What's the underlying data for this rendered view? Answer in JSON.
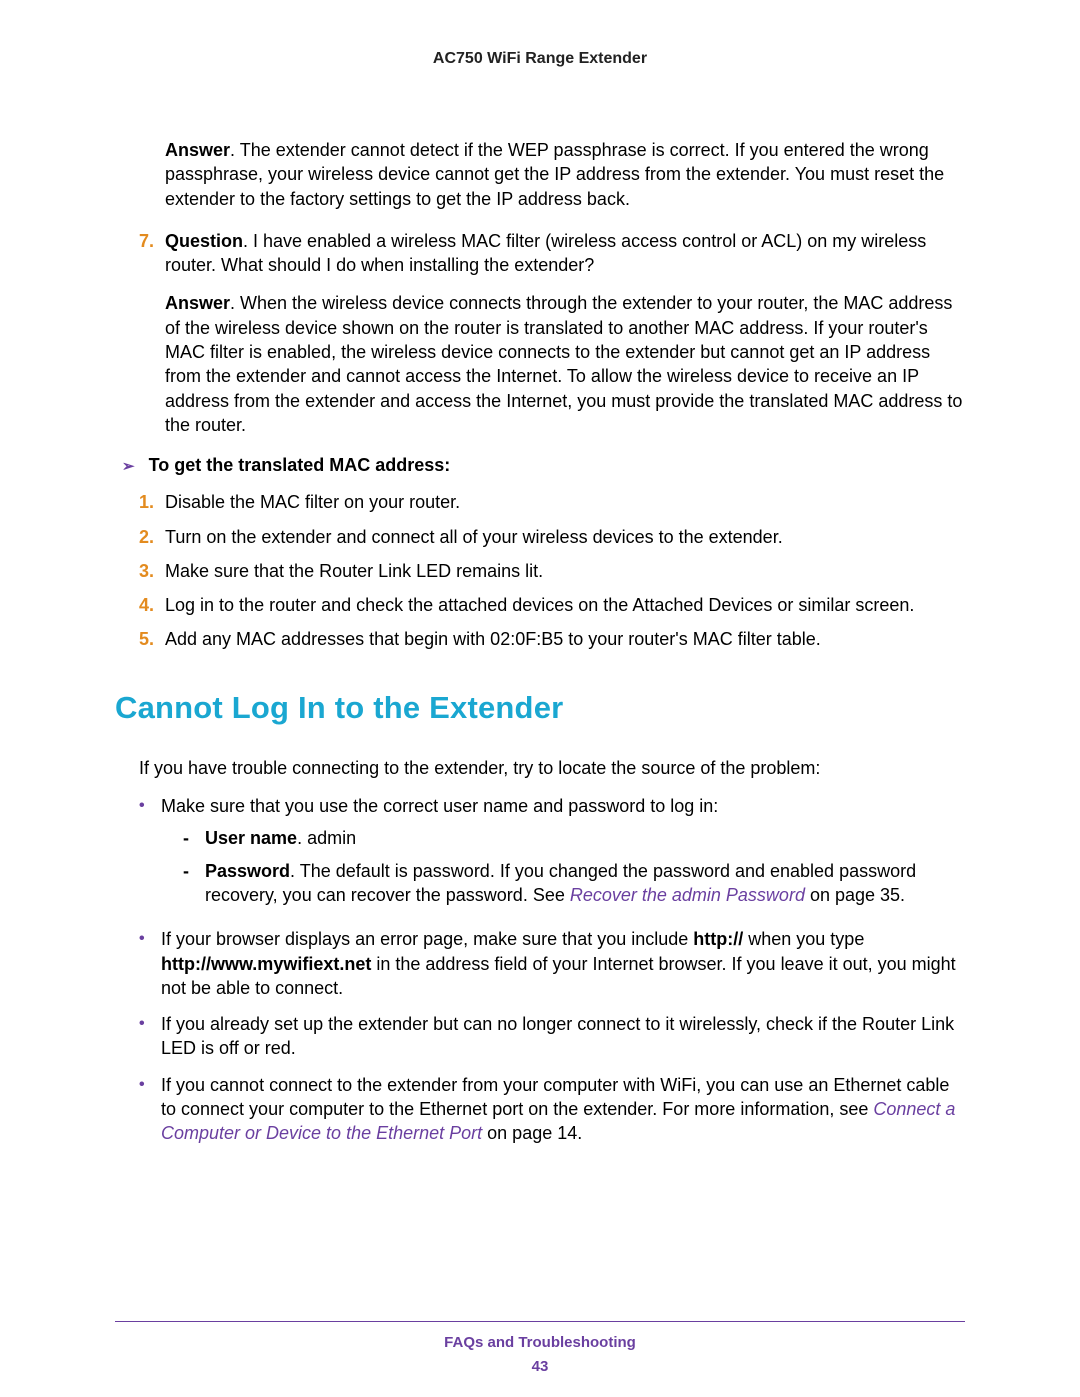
{
  "header": {
    "title": "AC750 WiFi Range Extender"
  },
  "faq": {
    "a6_label": "Answer",
    "a6_text": ". The extender cannot detect if the WEP passphrase is correct. If you entered the wrong passphrase, your wireless device cannot get the IP address from the extender. You must reset the extender to the factory settings to get the IP address back.",
    "q7_num": "7.",
    "q7_label": "Question",
    "q7_text": ". I have enabled a wireless MAC filter (wireless access control or ACL) on my wireless router. What should I do when installing the extender?",
    "a7_label": "Answer",
    "a7_text": ". When the wireless device connects through the extender to your router, the MAC address of the wireless device shown on the router is translated to another MAC address. If your router's MAC filter is enabled, the wireless device connects to the extender but cannot get an IP address from the extender and cannot access the Internet. To allow the wireless device to receive an IP address from the extender and access the Internet, you must provide the translated MAC address to the router."
  },
  "procedure": {
    "arrow": "➢",
    "heading": "To get the translated MAC address:",
    "steps": [
      {
        "n": "1.",
        "t": "Disable the MAC filter on your router."
      },
      {
        "n": "2.",
        "t": "Turn on the extender and connect all of your wireless devices to the extender."
      },
      {
        "n": "3.",
        "t": "Make sure that the Router Link LED remains lit."
      },
      {
        "n": "4.",
        "t": "Log in to the router and check the attached devices on the Attached Devices or similar screen."
      },
      {
        "n": "5.",
        "t": "Add any MAC addresses that begin with 02:0F:B5 to your router's MAC filter table."
      }
    ]
  },
  "section": {
    "heading": "Cannot Log In to the Extender",
    "intro": "If you have trouble connecting to the extender, try to locate the source of the problem:",
    "b1_lead": "Make sure that you use the correct user name and password to log in:",
    "b1_sub1_label": "User name",
    "b1_sub1_text": ". admin",
    "b1_sub2_label": "Password",
    "b1_sub2_pre": ". The default is password. If you changed the password and enabled password recovery, you can recover the password. See ",
    "b1_sub2_link": "Recover the admin Password",
    "b1_sub2_post": " on page 35.",
    "b2_pre": "If your browser displays an error page, make sure that you include ",
    "b2_bold1": "http://",
    "b2_mid": " when you type ",
    "b2_bold2": "http://www.mywifiext.net",
    "b2_post": " in the address field of your Internet browser. If you leave it out, you might not be able to connect.",
    "b3": "If you already set up the extender but can no longer connect to it wirelessly, check if the Router Link LED is off or red.",
    "b4_pre": "If you cannot connect to the extender from your computer with WiFi, you can use an Ethernet cable to connect your computer to the Ethernet port on the extender. For more information, see ",
    "b4_link": "Connect a Computer or Device to the Ethernet Port",
    "b4_post": " on page 14."
  },
  "footer": {
    "section": "FAQs and Troubleshooting",
    "page": "43"
  }
}
